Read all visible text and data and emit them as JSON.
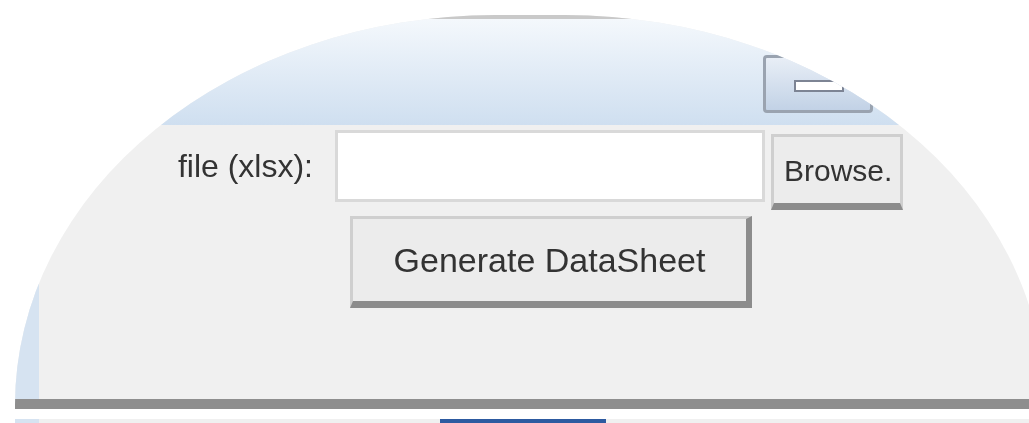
{
  "form": {
    "file_label": "file (xlsx):",
    "browse_button": "Browse.",
    "generate_button": "Generate DataSheet"
  }
}
